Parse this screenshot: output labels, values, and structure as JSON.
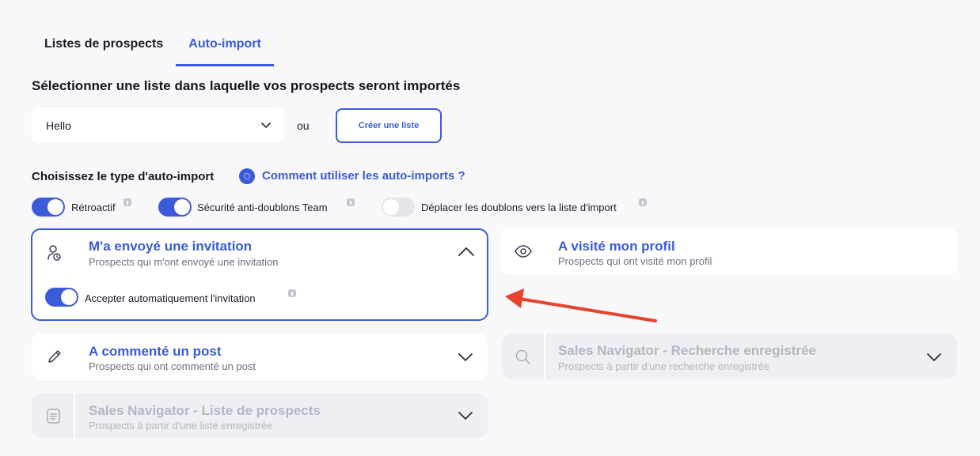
{
  "tabs": [
    {
      "label": "Listes de prospects",
      "active": false
    },
    {
      "label": "Auto-import",
      "active": true
    }
  ],
  "list_section": {
    "title": "Sélectionner une liste dans laquelle vos prospects seront importés",
    "selected_list": "Hello",
    "or_label": "ou",
    "create_button": "Créer une liste"
  },
  "type_section": {
    "title": "Choisissez le type d'auto-import",
    "help_link": "Comment utiliser les auto-imports ?"
  },
  "options": [
    {
      "label": "Rétroactif",
      "enabled": true
    },
    {
      "label": "Sécurité anti-doublons Team",
      "enabled": true
    },
    {
      "label": "Déplacer les doublons vers la liste d'import",
      "enabled": false
    }
  ],
  "cards": {
    "invitation": {
      "title": "M'a envoyé une invitation",
      "subtitle": "Prospects qui m'ont envoyé une invitation",
      "icon": "user-clock-icon",
      "expanded": true,
      "accept_label": "Accepter automatiquement l'invitation",
      "accept_enabled": true
    },
    "profile_visit": {
      "title": "A visité mon profil",
      "subtitle": "Prospects qui ont visité mon profil",
      "icon": "eye-icon"
    },
    "commented": {
      "title": "A commenté un post",
      "subtitle": "Prospects qui ont commenté un post",
      "icon": "pencil-icon"
    },
    "sn_search": {
      "title": "Sales Navigator - Recherche enregistrée",
      "subtitle": "Prospects à partir d'une recherche enregistrée",
      "icon": "search-icon",
      "disabled": true
    },
    "sn_list": {
      "title": "Sales Navigator - Liste de prospects",
      "subtitle": "Prospects à partir d'une liste enregistrée",
      "icon": "document-icon",
      "disabled": true
    }
  },
  "colors": {
    "accent": "#3b5bdb",
    "annotation_arrow": "#e8412c",
    "background": "#f8f8fa"
  }
}
